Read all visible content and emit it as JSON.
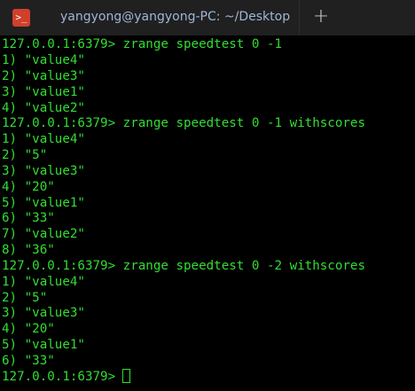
{
  "tab": {
    "icon_glyph": ">_",
    "title": "yangyong@yangyong-PC: ~/Desktop"
  },
  "new_tab": {
    "glyph": "+"
  },
  "colors": {
    "text": "#33dd33",
    "background": "#000000",
    "tabbar": "#202020",
    "tab_icon": "#d0402b",
    "tab_title": "#9fb6d6"
  },
  "terminal": {
    "lines": [
      "127.0.0.1:6379> zrange speedtest 0 -1",
      "1) \"value4\"",
      "2) \"value3\"",
      "3) \"value1\"",
      "4) \"value2\"",
      "127.0.0.1:6379> zrange speedtest 0 -1 withscores",
      "1) \"value4\"",
      "2) \"5\"",
      "3) \"value3\"",
      "4) \"20\"",
      "5) \"value1\"",
      "6) \"33\"",
      "7) \"value2\"",
      "8) \"36\"",
      "127.0.0.1:6379> zrange speedtest 0 -2 withscores",
      "1) \"value4\"",
      "2) \"5\"",
      "3) \"value3\"",
      "4) \"20\"",
      "5) \"value1\"",
      "6) \"33\""
    ],
    "prompt": "127.0.0.1:6379>"
  }
}
